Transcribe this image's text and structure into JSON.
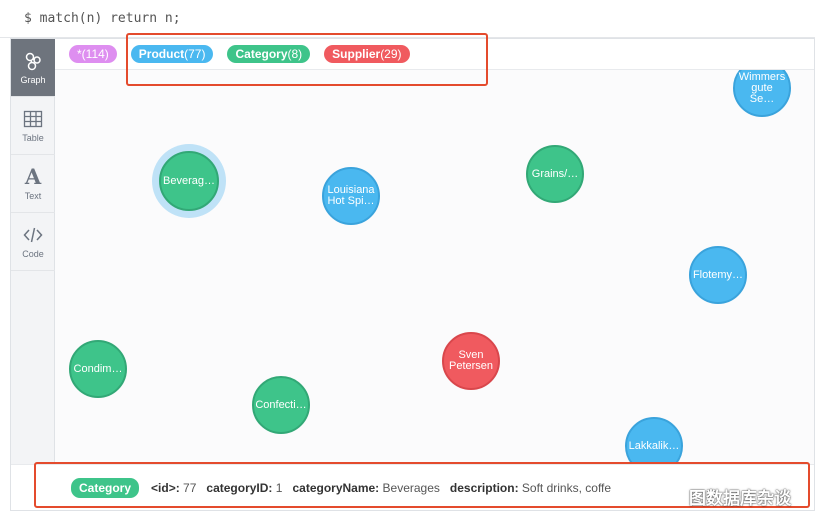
{
  "query": {
    "text": "$ match(n) return n;"
  },
  "sidebar": {
    "items": [
      {
        "label": "Graph",
        "icon": "graph-icon",
        "active": true
      },
      {
        "label": "Table",
        "icon": "table-icon"
      },
      {
        "label": "Text",
        "icon": "text-icon",
        "glyph": "A"
      },
      {
        "label": "Code",
        "icon": "code-icon"
      }
    ]
  },
  "legend": {
    "all": {
      "label": "*",
      "count": "(114)",
      "color": "#de8ef0"
    },
    "product": {
      "label": "Product",
      "count": "(77)",
      "color": "#4ab8f0"
    },
    "category": {
      "label": "Category",
      "count": "(8)",
      "color": "#3ec48a"
    },
    "supplier": {
      "label": "Supplier",
      "count": "(29)",
      "color": "#f05a5f"
    }
  },
  "nodes": [
    {
      "label": "Wimmers\ngute Se…",
      "type": "prod"
    },
    {
      "label": "Beverag…",
      "type": "cat"
    },
    {
      "label": "Louisiana\nHot Spi…",
      "type": "prod"
    },
    {
      "label": "Grains/…",
      "type": "cat"
    },
    {
      "label": "Flotemy…",
      "type": "prod"
    },
    {
      "label": "Condim…",
      "type": "cat"
    },
    {
      "label": "Sven\nPetersen",
      "type": "sup"
    },
    {
      "label": "Confecti…",
      "type": "cat"
    },
    {
      "label": "Lakkalik…",
      "type": "prod"
    }
  ],
  "details": {
    "tag": "Category",
    "props": [
      {
        "key": "<id>:",
        "value": "77"
      },
      {
        "key": "categoryID:",
        "value": "1"
      },
      {
        "key": "categoryName:",
        "value": "Beverages"
      },
      {
        "key": "description:",
        "value": "Soft drinks, coffe"
      }
    ]
  },
  "watermark": {
    "text": "图数据库杂谈"
  }
}
